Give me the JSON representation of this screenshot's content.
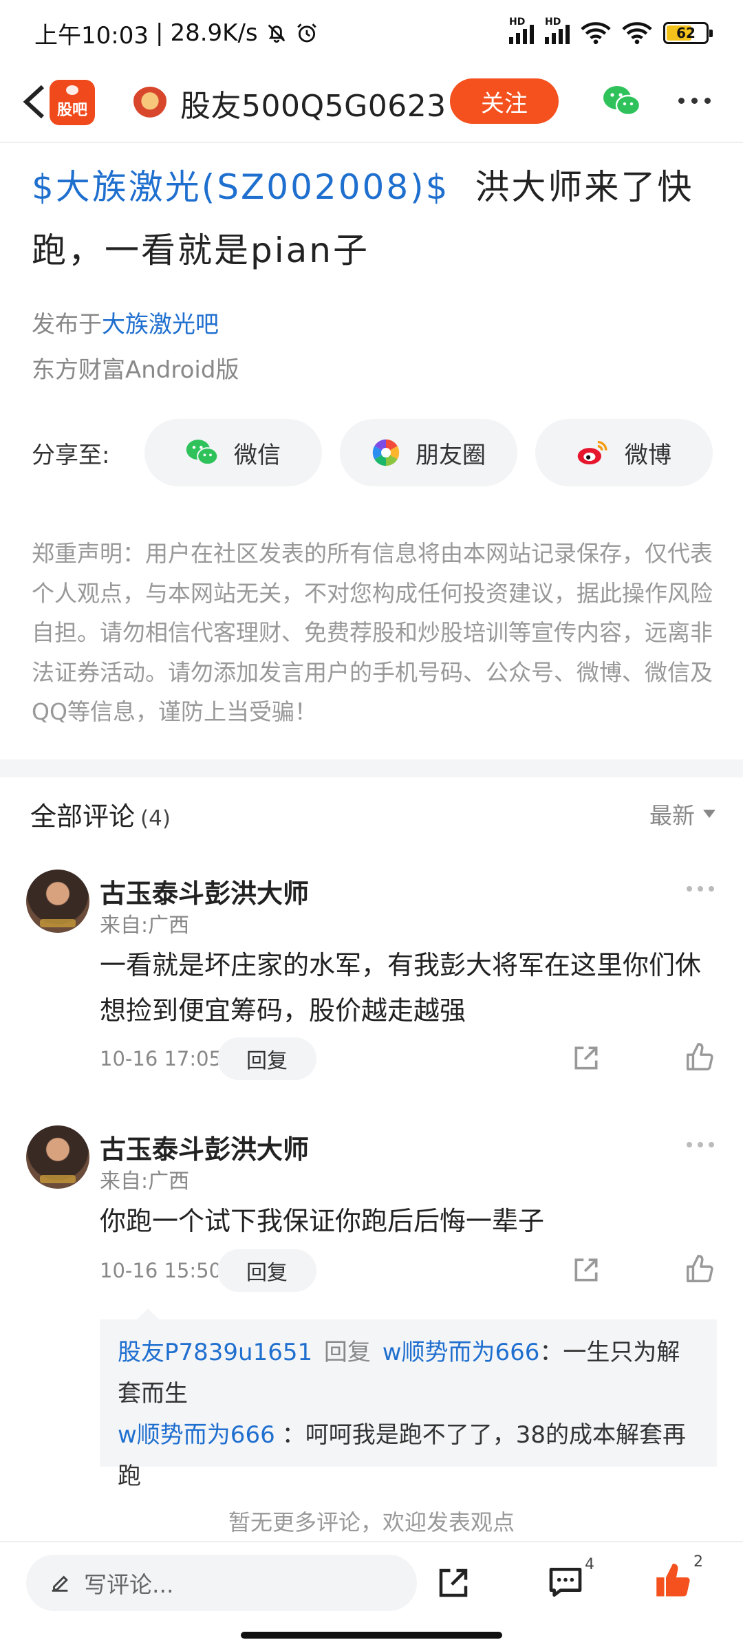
{
  "status_bar": {
    "time": "上午10:03",
    "speed": "28.9K/s",
    "battery": "62",
    "hd1": "HD",
    "hd2": "HD"
  },
  "header": {
    "app_name": "股吧",
    "username": "股友500Q5G0623",
    "follow_label": "关注"
  },
  "post": {
    "stock_tag": "$大族激光(SZ002008)$",
    "text_line1": "洪大师来了快",
    "text_line2": "跑，一看就是pian子",
    "published_prefix": "发布于",
    "bar_name": "大族激光吧",
    "client": "东方财富Android版"
  },
  "share": {
    "label": "分享至:",
    "wechat": "微信",
    "moments": "朋友圈",
    "weibo": "微博"
  },
  "disclaimer": "郑重声明：用户在社区发表的所有信息将由本网站记录保存，仅代表个人观点，与本网站无关，不对您构成任何投资建议，据此操作风险自担。请勿相信代客理财、免费荐股和炒股培训等宣传内容，远离非法证券活动。请勿添加发言用户的手机号码、公众号、微博、微信及QQ等信息，谨防上当受骗！",
  "comments_section": {
    "title": "全部评论",
    "count": "(4)",
    "sort": "最新"
  },
  "comments": [
    {
      "name": "古玉泰斗彭洪大师",
      "location": "来自:广西",
      "text": "一看就是坏庄家的水军，有我彭大将军在这里你们休想捡到便宜筹码，股价越走越强",
      "time": "10-16 17:05",
      "reply_label": "回复"
    },
    {
      "name": "古玉泰斗彭洪大师",
      "location": "来自:广西",
      "text": "你跑一个试下我保证你跑后后悔一辈子",
      "time": "10-16 15:50",
      "reply_label": "回复"
    }
  ],
  "replies": [
    {
      "user": "股友P7839u1651",
      "reply_word": "回复",
      "target": "w顺势而为666",
      "text": "：一生只为解套而生"
    },
    {
      "user": "w顺势而为666",
      "text": "：呵呵我是跑不了了，38的成本解套再跑"
    }
  ],
  "no_more": "暂无更多评论，欢迎发表观点",
  "bottom_bar": {
    "input_placeholder": "写评论...",
    "comment_count": "4",
    "like_count": "2"
  }
}
